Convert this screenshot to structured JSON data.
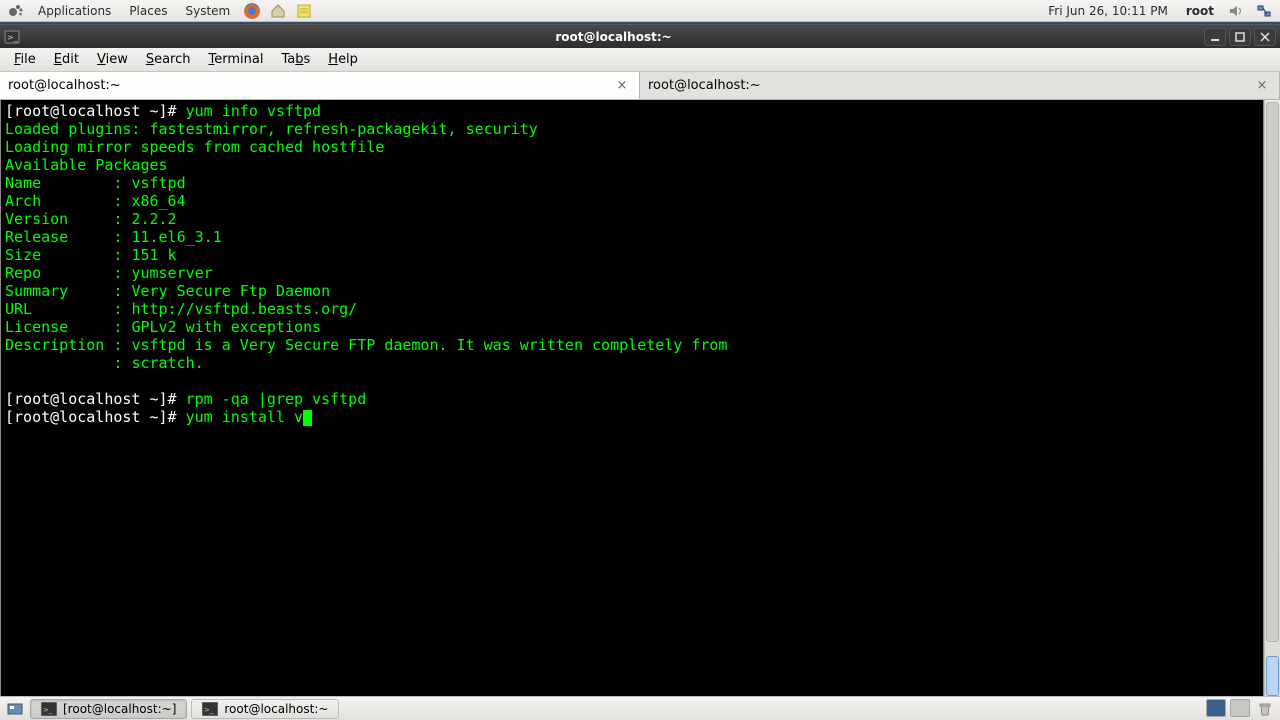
{
  "panel": {
    "apps": "Applications",
    "places": "Places",
    "system": "System",
    "clock": "Fri Jun 26, 10:11 PM",
    "user": "root"
  },
  "window": {
    "title": "root@localhost:~",
    "menus": {
      "file": "File",
      "edit": "Edit",
      "view": "View",
      "search": "Search",
      "terminal": "Terminal",
      "tabs": "Tabs",
      "help": "Help"
    },
    "tab1": "root@localhost:~",
    "tab2": "root@localhost:~"
  },
  "term": {
    "p": "[root@localhost ~]# ",
    "cmd1": "yum info vsftpd",
    "l1": "Loaded plugins: fastestmirror, refresh-packagekit, security",
    "l2": "Loading mirror speeds from cached hostfile",
    "l3": "Available Packages",
    "name_k": "Name        : ",
    "name_v": "vsftpd",
    "arch_k": "Arch        : ",
    "arch_v": "x86_64",
    "ver_k": "Version     : ",
    "ver_v": "2.2.2",
    "rel_k": "Release     : ",
    "rel_v": "11.el6_3.1",
    "size_k": "Size        : ",
    "size_v": "151 k",
    "repo_k": "Repo        : ",
    "repo_v": "yumserver",
    "sum_k": "Summary     : ",
    "sum_v": "Very Secure Ftp Daemon",
    "url_k": "URL         : ",
    "url_v": "http://vsftpd.beasts.org/",
    "lic_k": "License     : ",
    "lic_v": "GPLv2 with exceptions",
    "desc_k": "Description : ",
    "desc_v": "vsftpd is a Very Secure FTP daemon. It was written completely from",
    "desc2_k": "            : ",
    "desc2_v": "scratch.",
    "cmd2": "rpm -qa |grep vsftpd",
    "cmd3": "yum install v"
  },
  "task": {
    "btn1": "[root@localhost:~]",
    "btn2": "root@localhost:~"
  }
}
